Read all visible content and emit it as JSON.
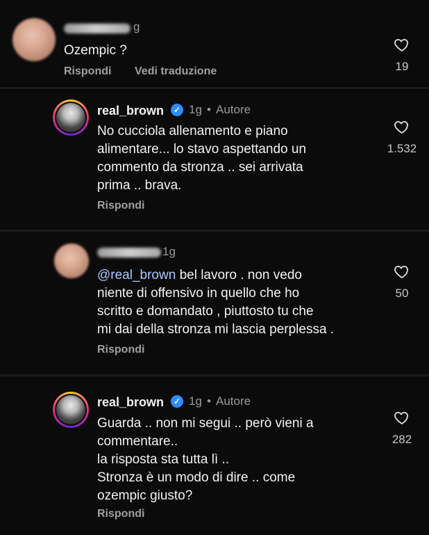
{
  "comments": [
    {
      "time": "g",
      "text": "Ozempic ?",
      "actions": [
        "Rispondi",
        "Vedi traduzione"
      ],
      "likes": "19"
    },
    {
      "username": "real_brown",
      "time": "1g",
      "role": "Autore",
      "text": "No cucciola allenamento e piano\nalimentare... lo stavo aspettando un\ncommento da stronza .. sei arrivata\nprima .. brava.",
      "actions": [
        "Rispondi"
      ],
      "likes": "1.532"
    },
    {
      "time": "1g",
      "mention": "@real_brown",
      "text_after_mention": " bel lavoro . non vedo",
      "text_rest": "niente di offensivo in quello che ho\nscritto e domandato ,  piuttosto tu che\nmi dai della stronza mi lascia perplessa .",
      "actions": [
        "Rispondi"
      ],
      "likes": "50"
    },
    {
      "username": "real_brown",
      "time": "1g",
      "role": "Autore",
      "text": "Guarda .. non mi segui .. però vieni a\ncommentare..\nla risposta sta tutta lì ..\nStronza è un modo di dire .. come\nozempic giusto?",
      "actions": [
        "Rispondi"
      ],
      "likes": "282"
    }
  ],
  "separator": "•",
  "icons": {
    "verified": "verified-badge-icon",
    "like": "heart-icon"
  },
  "colors": {
    "background": "#0b0b0c",
    "verified": "#2f8cff",
    "mention": "#a9c8ff",
    "muted": "#9a9a9a"
  }
}
